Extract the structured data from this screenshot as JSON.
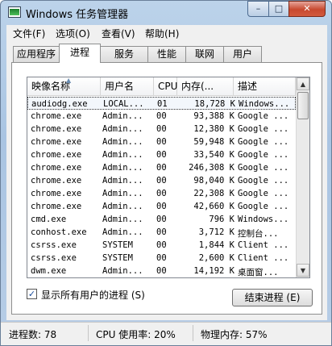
{
  "window": {
    "title": "Windows 任务管理器",
    "min_label": "–",
    "max_label": "□",
    "close_label": "✕"
  },
  "menu": [
    "文件(F)",
    "选项(O)",
    "查看(V)",
    "帮助(H)"
  ],
  "tabs": [
    "应用程序",
    "进程",
    "服务",
    "性能",
    "联网",
    "用户"
  ],
  "active_tab": "进程",
  "columns": [
    "映像名称",
    "用户名",
    "CPU",
    "内存(...",
    "描述"
  ],
  "processes": [
    {
      "name": "audiodg.exe",
      "user": "LOCAL...",
      "cpu": "01",
      "mem": "18,728 K",
      "desc": "Windows..."
    },
    {
      "name": "chrome.exe",
      "user": "Admin...",
      "cpu": "00",
      "mem": "93,388 K",
      "desc": "Google ..."
    },
    {
      "name": "chrome.exe",
      "user": "Admin...",
      "cpu": "00",
      "mem": "12,380 K",
      "desc": "Google ..."
    },
    {
      "name": "chrome.exe",
      "user": "Admin...",
      "cpu": "00",
      "mem": "59,948 K",
      "desc": "Google ..."
    },
    {
      "name": "chrome.exe",
      "user": "Admin...",
      "cpu": "00",
      "mem": "33,540 K",
      "desc": "Google ..."
    },
    {
      "name": "chrome.exe",
      "user": "Admin...",
      "cpu": "00",
      "mem": "246,308 K",
      "desc": "Google ..."
    },
    {
      "name": "chrome.exe",
      "user": "Admin...",
      "cpu": "00",
      "mem": "98,040 K",
      "desc": "Google ..."
    },
    {
      "name": "chrome.exe",
      "user": "Admin...",
      "cpu": "00",
      "mem": "22,308 K",
      "desc": "Google ..."
    },
    {
      "name": "chrome.exe",
      "user": "Admin...",
      "cpu": "00",
      "mem": "42,660 K",
      "desc": "Google ..."
    },
    {
      "name": "cmd.exe",
      "user": "Admin...",
      "cpu": "00",
      "mem": "796 K",
      "desc": "Windows..."
    },
    {
      "name": "conhost.exe",
      "user": "Admin...",
      "cpu": "00",
      "mem": "3,712 K",
      "desc": "控制台..."
    },
    {
      "name": "csrss.exe",
      "user": "SYSTEM",
      "cpu": "00",
      "mem": "1,844 K",
      "desc": "Client ..."
    },
    {
      "name": "csrss.exe",
      "user": "SYSTEM",
      "cpu": "00",
      "mem": "2,600 K",
      "desc": "Client ..."
    },
    {
      "name": "dwm.exe",
      "user": "Admin...",
      "cpu": "00",
      "mem": "14,192 K",
      "desc": "桌面窗..."
    },
    {
      "name": "EXCEL.EXE *32",
      "user": "Admin...",
      "cpu": "00",
      "mem": "13,344 K",
      "desc": "Micros..."
    }
  ],
  "selected_row": 0,
  "show_all_users": {
    "label": "显示所有用户的进程 (S)",
    "checked": true,
    "check_mark": "✓"
  },
  "end_process_label": "结束进程 (E)",
  "status": {
    "process_count": "进程数: 78",
    "cpu_usage": "CPU 使用率: 20%",
    "physical_memory": "物理内存: 57%"
  }
}
